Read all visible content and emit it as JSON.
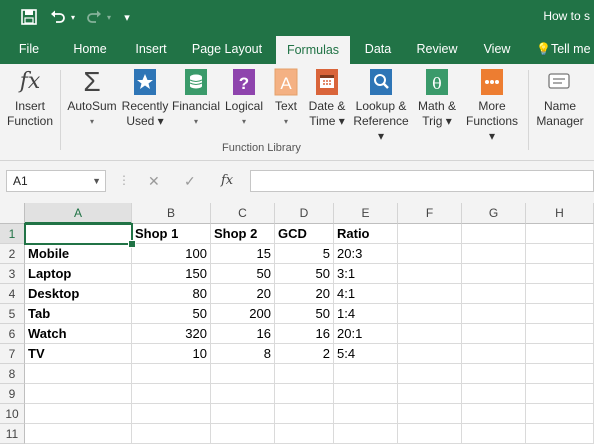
{
  "window": {
    "title": "How to s"
  },
  "qat": {
    "customize_label": "▾"
  },
  "tabs": [
    {
      "label": "File"
    },
    {
      "label": "Home"
    },
    {
      "label": "Insert"
    },
    {
      "label": "Page Layout"
    },
    {
      "label": "Formulas",
      "active": true
    },
    {
      "label": "Data"
    },
    {
      "label": "Review"
    },
    {
      "label": "View"
    },
    {
      "label": "Tell me"
    }
  ],
  "ribbon": {
    "group_label": "Function Library",
    "buttons": [
      {
        "line1": "Insert",
        "line2": "Function",
        "icon": "fx-icon"
      },
      {
        "line1": "AutoSum",
        "line2": "▾",
        "icon": "sigma-icon"
      },
      {
        "line1": "Recently",
        "line2": "Used ▾",
        "icon": "star-book-icon"
      },
      {
        "line1": "Financial",
        "line2": "▾",
        "icon": "coins-book-icon"
      },
      {
        "line1": "Logical",
        "line2": "▾",
        "icon": "question-book-icon"
      },
      {
        "line1": "Text",
        "line2": "▾",
        "icon": "text-book-icon"
      },
      {
        "line1": "Date &",
        "line2": "Time ▾",
        "icon": "calendar-book-icon"
      },
      {
        "line1": "Lookup &",
        "line2": "Reference ▾",
        "icon": "search-book-icon"
      },
      {
        "line1": "Math &",
        "line2": "Trig ▾",
        "icon": "theta-book-icon"
      },
      {
        "line1": "More",
        "line2": "Functions ▾",
        "icon": "dots-book-icon"
      },
      {
        "line1": "Name",
        "line2": "Manager",
        "icon": "name-tag-icon"
      }
    ]
  },
  "formula_bar": {
    "name_box": "A1",
    "fx_label": "fx",
    "value": ""
  },
  "sheet": {
    "columns": [
      "A",
      "B",
      "C",
      "D",
      "E",
      "F",
      "G",
      "H"
    ],
    "rows": [
      "1",
      "2",
      "3",
      "4",
      "5",
      "6",
      "7",
      "8",
      "9",
      "10",
      "11"
    ],
    "selected_cell": "A1",
    "header_row": [
      "",
      "Shop 1",
      "Shop 2",
      "GCD",
      "Ratio"
    ],
    "data_rows": [
      [
        "Mobile",
        "100",
        "15",
        "5",
        "20:3"
      ],
      [
        "Laptop",
        "150",
        "50",
        "50",
        "3:1"
      ],
      [
        "Desktop",
        "80",
        "20",
        "20",
        "4:1"
      ],
      [
        "Tab",
        "50",
        "200",
        "50",
        "1:4"
      ],
      [
        "Watch",
        "320",
        "16",
        "16",
        "20:1"
      ],
      [
        "TV",
        "10",
        "8",
        "2",
        "5:4"
      ]
    ]
  }
}
